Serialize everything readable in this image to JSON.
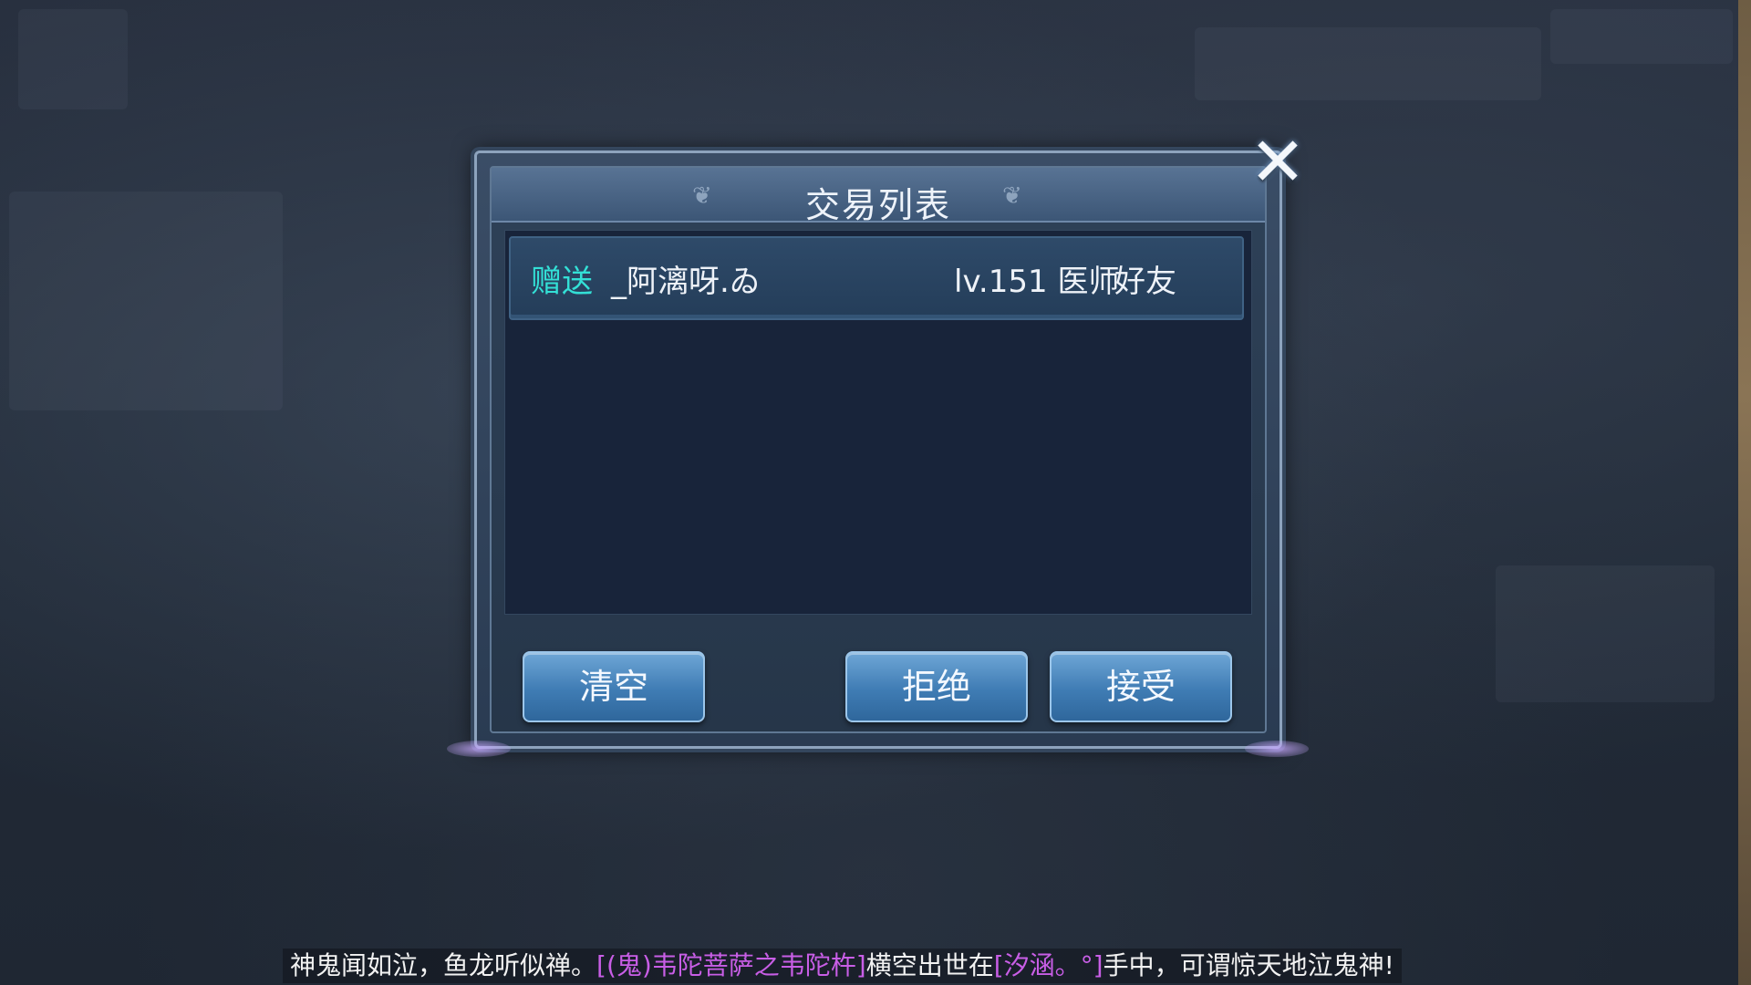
{
  "dialog": {
    "title": "交易列表",
    "rows": [
      {
        "type": "赠送",
        "name": "_阿漓呀.ゐ",
        "level": "lv.151 医师",
        "relation": "好友"
      }
    ],
    "buttons": {
      "clear": "清空",
      "reject": "拒绝",
      "accept": "接受"
    },
    "close_symbol": "✕"
  },
  "broadcast": {
    "part1": "神鬼闻如泣，鱼龙听似禅。",
    "item": "[(鬼)韦陀菩萨之韦陀杵]",
    "part2": "横空出世在",
    "player": "[汐涵。°]",
    "part3": "手中，可谓惊天地泣鬼神!"
  },
  "colors": {
    "trade_type": "#33e0d6",
    "highlight_purple": "#c85ee6",
    "button_blue": "#3f7cb4"
  }
}
